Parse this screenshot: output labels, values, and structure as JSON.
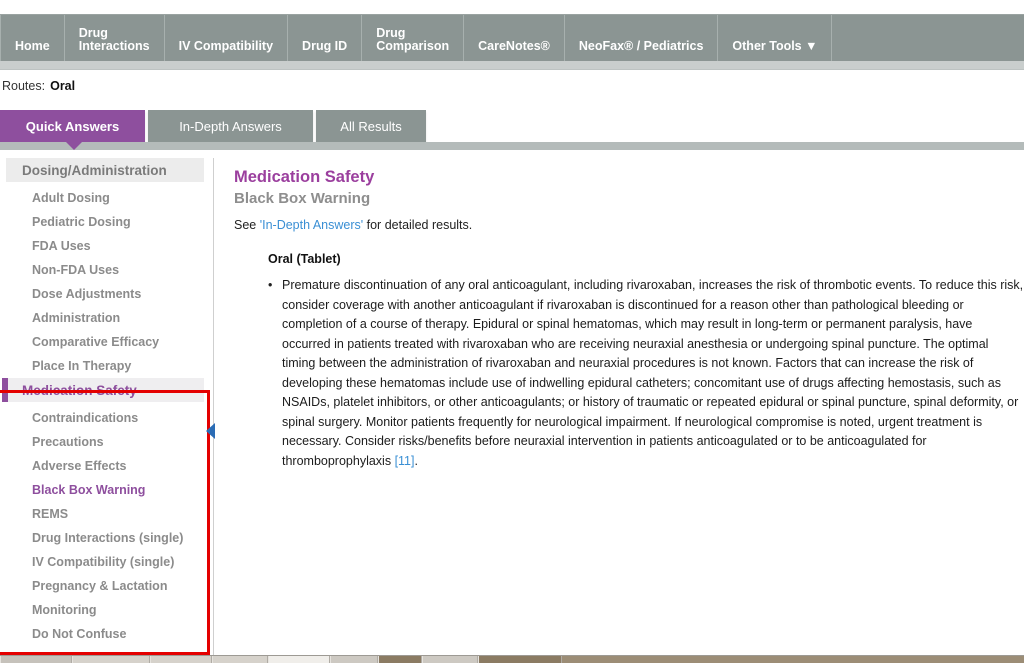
{
  "topnav": {
    "items": [
      {
        "label": "Home"
      },
      {
        "label": "Drug\nInteractions"
      },
      {
        "label": "IV Compatibility"
      },
      {
        "label": "Drug ID"
      },
      {
        "label": "Drug\nComparison"
      },
      {
        "label": "CareNotes®"
      },
      {
        "label": "NeoFax® / Pediatrics"
      },
      {
        "label": "Other Tools ▼"
      }
    ]
  },
  "routes": {
    "label": "Routes:",
    "value": "Oral"
  },
  "answer_tabs": {
    "items": [
      {
        "label": "Quick Answers",
        "selected": true
      },
      {
        "label": "In-Depth Answers",
        "selected": false
      },
      {
        "label": "All Results",
        "selected": false
      }
    ]
  },
  "sidebar": {
    "sections": [
      {
        "header": "Dosing/Administration",
        "active": false,
        "items": [
          {
            "label": "Adult Dosing",
            "highlight": false
          },
          {
            "label": "Pediatric Dosing",
            "highlight": false
          },
          {
            "label": "FDA Uses",
            "highlight": false
          },
          {
            "label": "Non-FDA Uses",
            "highlight": false
          },
          {
            "label": "Dose Adjustments",
            "highlight": false
          },
          {
            "label": "Administration",
            "highlight": false
          },
          {
            "label": "Comparative Efficacy",
            "highlight": false
          },
          {
            "label": "Place In Therapy",
            "highlight": false
          }
        ]
      },
      {
        "header": "Medication Safety",
        "active": true,
        "items": [
          {
            "label": "Contraindications",
            "highlight": false
          },
          {
            "label": "Precautions",
            "highlight": false
          },
          {
            "label": "Adverse Effects",
            "highlight": false
          },
          {
            "label": "Black Box Warning",
            "highlight": true
          },
          {
            "label": "REMS",
            "highlight": false
          },
          {
            "label": "Drug Interactions (single)",
            "highlight": false
          },
          {
            "label": "IV Compatibility (single)",
            "highlight": false
          },
          {
            "label": "Pregnancy & Lactation",
            "highlight": false
          },
          {
            "label": "Monitoring",
            "highlight": false
          },
          {
            "label": "Do Not Confuse",
            "highlight": false
          }
        ]
      }
    ]
  },
  "main": {
    "title": "Medication Safety",
    "subtitle": "Black Box Warning",
    "see_prefix": "See ",
    "see_link": "'In-Depth Answers'",
    "see_suffix": " for detailed results.",
    "route_heading": "Oral (Tablet)",
    "bullet_marker": "•",
    "bullet_text": "Premature discontinuation of any oral anticoagulant, including rivaroxaban, increases the risk of thrombotic events. To reduce this risk, consider coverage with another anticoagulant if rivaroxaban is discontinued for a reason other than pathological bleeding or completion of a course of therapy. Epidural or spinal hematomas, which may result in long-term or permanent paralysis, have occurred in patients treated with rivaroxaban who are receiving neuraxial anesthesia or undergoing spinal puncture. The optimal timing between the administration of rivaroxaban and neuraxial procedures is not known. Factors that can increase the risk of developing these hematomas include use of indwelling epidural catheters; concomitant use of drugs affecting hemostasis, such as NSAIDs, platelet inhibitors, or other anticoagulants; or history of traumatic or repeated epidural or spinal puncture, spinal deformity, or spinal surgery. Monitor patients frequently for neurological impairment. If neurological compromise is noted, urgent treatment is necessary. Consider risks/benefits before neuraxial intervention in patients anticoagulated or to be anticoagulated for thromboprophylaxis ",
    "bullet_reference": "[11]",
    "bullet_text_end": "."
  },
  "annotation": {
    "highlight_color": "#e40000"
  },
  "colors": {
    "nav_background": "#8b9593",
    "accent_purple": "#8e4f9e",
    "link_blue": "#3a8fd4",
    "tab_inactive": "#8b9593"
  }
}
